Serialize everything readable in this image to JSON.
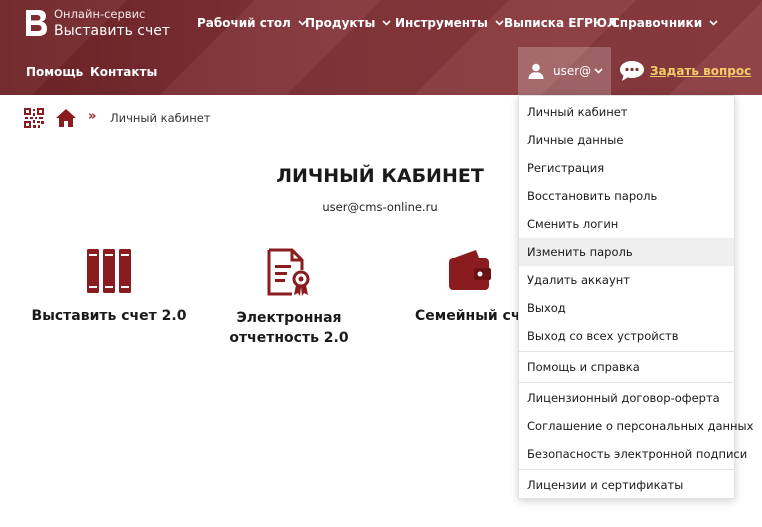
{
  "brand": {
    "subtitle": "Онлайн-сервис",
    "title": "Выставить счет"
  },
  "nav_primary": [
    {
      "label": "Рабочий стол",
      "has_dropdown": true
    },
    {
      "label": "Продукты",
      "has_dropdown": true
    },
    {
      "label": "Инструменты",
      "has_dropdown": true
    },
    {
      "label": "Выписка ЕГРЮЛ",
      "has_dropdown": false
    },
    {
      "label": "Справочники",
      "has_dropdown": true
    }
  ],
  "nav_secondary": [
    {
      "label": "Помощь"
    },
    {
      "label": "Контакты"
    }
  ],
  "user_menu": {
    "username": "user@",
    "ask_question": "Задать вопрос",
    "items": [
      {
        "label": "Личный кабинет"
      },
      {
        "label": "Личные данные"
      },
      {
        "label": "Регистрация"
      },
      {
        "label": "Восстановить пароль"
      },
      {
        "label": "Сменить логин"
      },
      {
        "label": "Изменить пароль",
        "highlighted": true
      },
      {
        "label": "Удалить аккаунт"
      },
      {
        "label": "Выход"
      },
      {
        "label": "Выход со всех устройств"
      },
      {
        "label": "Помощь и справка"
      },
      {
        "label": "Лицензионный договор-оферта"
      },
      {
        "label": "Соглашение о персональных данных"
      },
      {
        "label": "Безопасность электронной подписи"
      },
      {
        "label": "Лицензии и сертификаты"
      }
    ]
  },
  "breadcrumb": {
    "separator": "»",
    "current": "Личный кабинет"
  },
  "main": {
    "title": "ЛИЧНЫЙ КАБИНЕТ",
    "email": "user@cms-online.ru",
    "tiles": [
      {
        "label": "Выставить счет 2.0",
        "icon": "books-icon"
      },
      {
        "label": "Электронная отчетность 2.0",
        "icon": "certificate-document-icon"
      },
      {
        "label": "Семейный счет",
        "icon": "wallet-icon"
      }
    ]
  },
  "colors": {
    "header_bg": "#7d2c2f",
    "accent": "#8a1c1f",
    "ask_link": "#f4cc6a",
    "highlight_bg": "#efefef"
  }
}
